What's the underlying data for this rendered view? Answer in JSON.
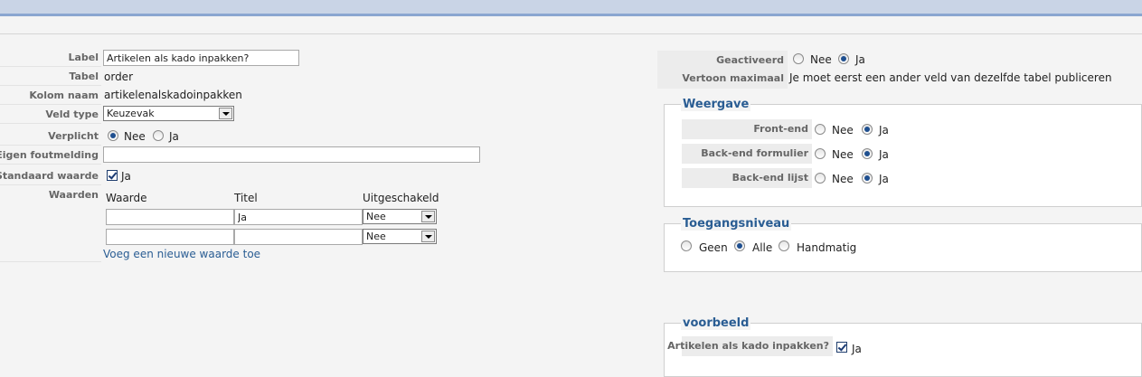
{
  "header": {
    "title": ""
  },
  "form": {
    "label": {
      "label": "Label",
      "value": "Artikelen als kado inpakken?"
    },
    "tabel": {
      "label": "Tabel",
      "value": "order"
    },
    "kolom": {
      "label": "Kolom naam",
      "value": "artikelenalskadoinpakken"
    },
    "veldtype": {
      "label": "Veld type",
      "value": "Keuzevak"
    },
    "verplicht": {
      "label": "Verplicht",
      "options": [
        "Nee",
        "Ja"
      ],
      "selected": "Nee"
    },
    "foutmelding": {
      "label": "Eigen foutmelding",
      "value": ""
    },
    "standaard": {
      "label": "Standaard waarde",
      "check_label": "Ja",
      "checked": true
    },
    "waarden": {
      "label": "Waarden",
      "headers": [
        "Waarde",
        "Titel",
        "Uitgeschakeld"
      ],
      "rows": [
        {
          "waarde": "",
          "titel": "Ja",
          "uitgeschakeld": "Nee"
        },
        {
          "waarde": "",
          "titel": "",
          "uitgeschakeld": "Nee"
        }
      ],
      "add_link": "Voeg een nieuwe waarde toe"
    }
  },
  "right": {
    "geactiveerd": {
      "label": "Geactiveerd",
      "options": [
        "Nee",
        "Ja"
      ],
      "selected": "Ja"
    },
    "vertoon": {
      "label": "Vertoon maximaal",
      "value": "Je moet eerst een ander veld van dezelfde tabel publiceren"
    },
    "weergave": {
      "legend": "Weergave",
      "rows": [
        {
          "label": "Front-end",
          "options": [
            "Nee",
            "Ja"
          ],
          "selected": "Ja"
        },
        {
          "label": "Back-end formulier",
          "options": [
            "Nee",
            "Ja"
          ],
          "selected": "Ja"
        },
        {
          "label": "Back-end lijst",
          "options": [
            "Nee",
            "Ja"
          ],
          "selected": "Ja"
        }
      ]
    },
    "toegang": {
      "legend": "Toegangsniveau",
      "options": [
        "Geen",
        "Alle",
        "Handmatig"
      ],
      "selected": "Alle"
    },
    "voorbeeld": {
      "legend": "voorbeeld",
      "label": "Artikelen als kado inpakken?",
      "check_label": "Ja",
      "checked": true
    }
  }
}
